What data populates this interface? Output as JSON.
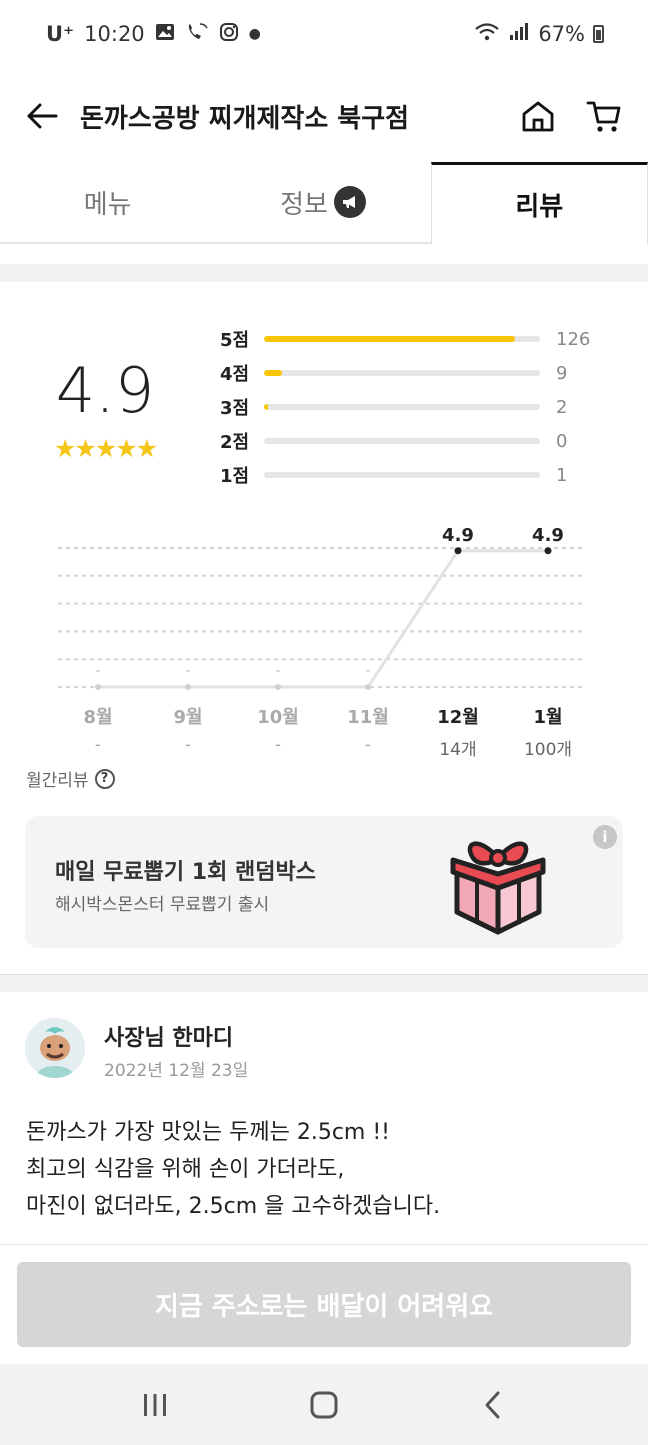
{
  "status": {
    "carrier": "U⁺",
    "time": "10:20",
    "battery": "67%",
    "left_icons": [
      "gallery-icon",
      "call-wifi-icon",
      "instagram-icon",
      "dot-icon"
    ],
    "right_icons": [
      "wifi-icon",
      "signal-icon",
      "battery-icon"
    ]
  },
  "header": {
    "title": "돈까스공방 찌개제작소 북구점",
    "icons": [
      "back-arrow-icon",
      "home-icon",
      "cart-icon"
    ]
  },
  "tabs": [
    {
      "label": "메뉴",
      "active": false
    },
    {
      "label": "정보",
      "active": false,
      "badge_icon": "megaphone-icon"
    },
    {
      "label": "리뷰",
      "active": true
    }
  ],
  "rating": {
    "average": "4.9",
    "stars": "★★★★★",
    "distribution": [
      {
        "label": "5점",
        "count": "126",
        "fraction": 0.91
      },
      {
        "label": "4점",
        "count": "9",
        "fraction": 0.065
      },
      {
        "label": "3점",
        "count": "2",
        "fraction": 0.015
      },
      {
        "label": "2점",
        "count": "0",
        "fraction": 0
      },
      {
        "label": "1점",
        "count": "1",
        "fraction": 0
      }
    ]
  },
  "chart_data": {
    "type": "line",
    "categories": [
      "8월",
      "9월",
      "10월",
      "11월",
      "12월",
      "1월"
    ],
    "values": [
      null,
      null,
      null,
      null,
      4.9,
      4.9
    ],
    "value_labels": [
      "-",
      "-",
      "-",
      "-",
      "4.9",
      "4.9"
    ],
    "counts": [
      "-",
      "-",
      "-",
      "-",
      "14개",
      "100개"
    ],
    "ylim": [
      0,
      5
    ],
    "grid": true
  },
  "monthly_label": "월간리뷰",
  "promo": {
    "title": "매일 무료뽑기 1회 랜덤박스",
    "subtitle": "해시박스몬스터 무료뽑기 출시",
    "info": "i",
    "icon": "gift-box-icon"
  },
  "owner": {
    "name": "사장님 한마디",
    "date": "2022년 12월 23일",
    "lines": [
      "돈까스가 가장 맛있는 두께는 2.5cm !!",
      "최고의 식감을 위해 손이 가더라도,",
      "마진이 없더라도, 2.5cm 을 고수하겠습니다."
    ]
  },
  "cta": {
    "label": "지금 주소로는 배달이 어려워요"
  },
  "navbar": {
    "icons": [
      "recents-icon",
      "home-nav-icon",
      "back-nav-icon"
    ]
  },
  "colors": {
    "accent": "#f7c600",
    "star": "#f5c518",
    "cta_bg": "#d6d6d6"
  }
}
